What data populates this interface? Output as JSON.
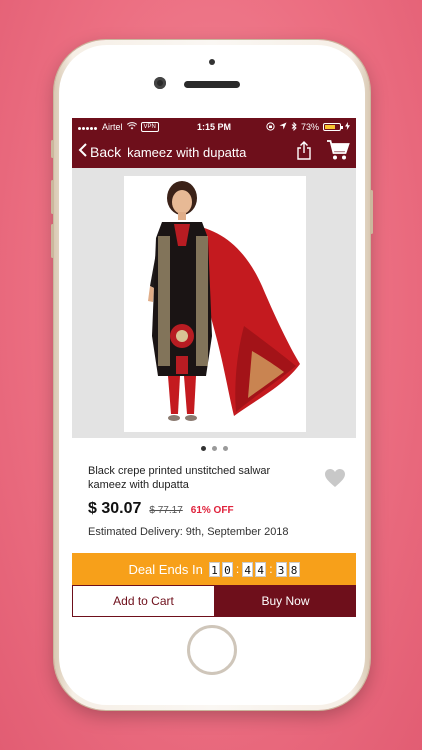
{
  "status_bar": {
    "carrier": "Airtel",
    "vpn_label": "VPN",
    "time": "1:15 PM",
    "battery_label": "73%",
    "battery_level": 0.73,
    "battery_color": "#f6c432"
  },
  "navbar": {
    "back_label": "Back",
    "title": "kameez with dupatta",
    "icons": [
      "share-icon",
      "cart-icon"
    ]
  },
  "gallery": {
    "page_count": 3,
    "active_page": 1
  },
  "product": {
    "name": "Black crepe printed unstitched salwar kameez with dupatta",
    "price": "$ 30.07",
    "old_price": "$ 77.17",
    "discount": "61% OFF",
    "delivery": "Estimated Delivery: 9th, September 2018"
  },
  "deal": {
    "label": "Deal Ends In",
    "digits": [
      "1",
      "0",
      "4",
      "4",
      "3",
      "8"
    ]
  },
  "actions": {
    "add_to_cart": "Add to Cart",
    "buy_now": "Buy Now"
  },
  "colors": {
    "brand": "#6e0f1b",
    "deal": "#f7a01a",
    "discount": "#e0223c",
    "background": "#ec6f82"
  }
}
